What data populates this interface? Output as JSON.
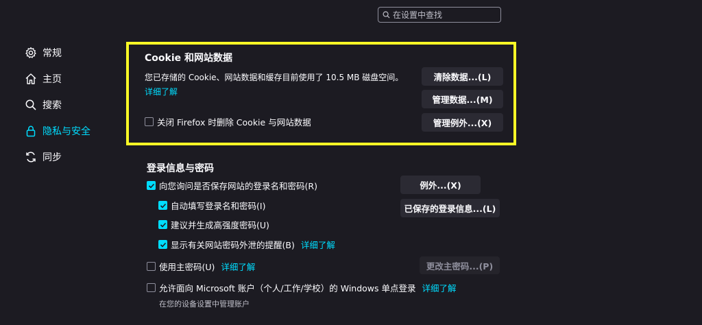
{
  "search": {
    "placeholder": "在设置中查找"
  },
  "sidebar": {
    "items": [
      {
        "label": "常规"
      },
      {
        "label": "主页"
      },
      {
        "label": "搜索"
      },
      {
        "label": "隐私与安全"
      },
      {
        "label": "同步"
      }
    ]
  },
  "cookies": {
    "title": "Cookie 和网站数据",
    "usage_text": "您已存储的 Cookie、网站数据和缓存目前使用了 10.5 MB 磁盘空间。",
    "learn_more": "详细了解",
    "delete_on_close_label": "关闭 Firefox 时删除 Cookie 与网站数据",
    "delete_on_close_checked": false,
    "clear_button": "清除数据...(L)",
    "manage_button": "管理数据...(M)",
    "exceptions_button": "管理例外...(X)"
  },
  "logins": {
    "title": "登录信息与密码",
    "ask_to_save_label": "向您询问是否保存网站的登录名和密码(R)",
    "autofill_label": "自动填写登录名和密码(I)",
    "suggest_label": "建议并生成高强度密码(U)",
    "breach_label": "显示有关网站密码外泄的提醒(B)",
    "breach_learn_more": "详细了解",
    "primary_password_label": "使用主密码(U)",
    "primary_learn_more": "详细了解",
    "windows_sso_label": "允许面向 Microsoft 账户（个人/工作/学校）的 Windows 单点登录",
    "windows_learn_more": "详细了解",
    "windows_sub": "在您的设备设置中管理账户",
    "exceptions_button": "例外...(X)",
    "saved_logins_button": "已保存的登录信息...(L)",
    "change_primary_button": "更改主密码...(P)"
  },
  "colors": {
    "accent": "#00ddff",
    "highlight_border": "#fbfb26",
    "background": "#1c1b22",
    "button": "#2b2a33"
  }
}
